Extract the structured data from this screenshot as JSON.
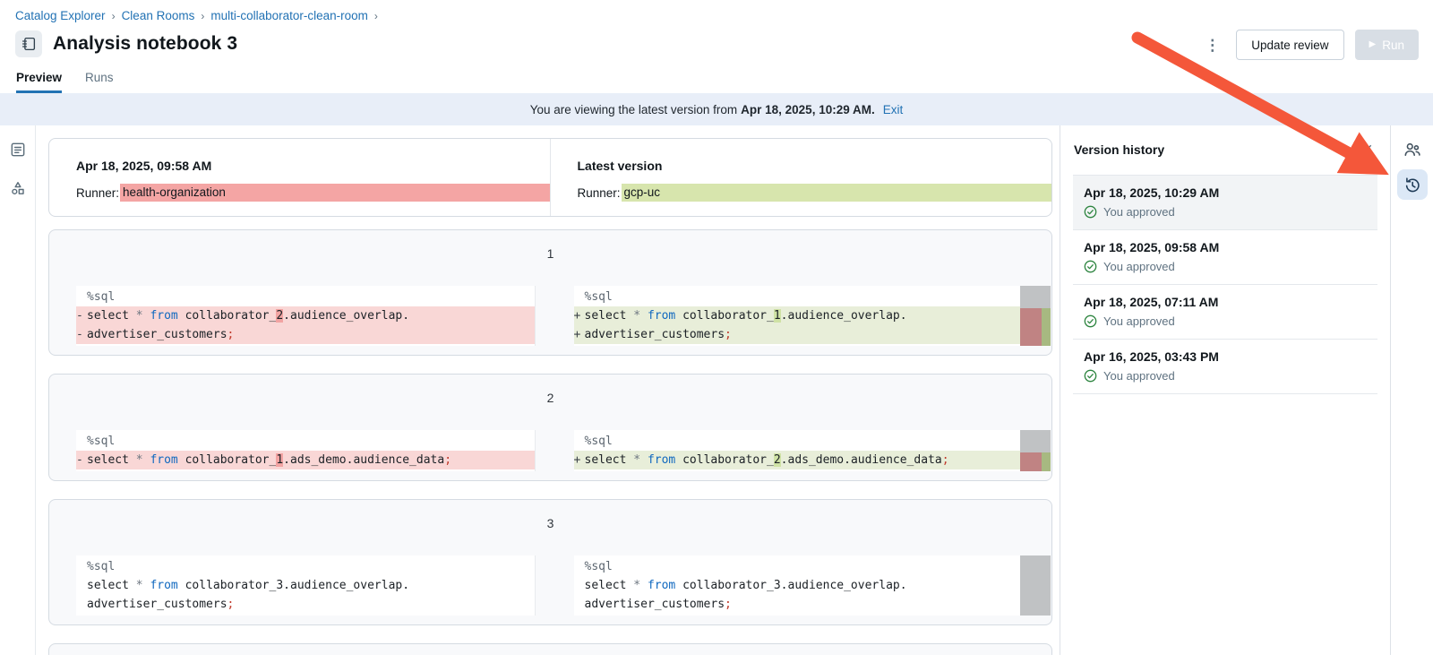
{
  "breadcrumb": {
    "items": [
      "Catalog Explorer",
      "Clean Rooms",
      "multi-collaborator-clean-room"
    ],
    "separator": "›"
  },
  "header": {
    "title": "Analysis notebook 3",
    "update_review_label": "Update review",
    "run_label": "Run"
  },
  "tabs": [
    {
      "label": "Preview",
      "active": true
    },
    {
      "label": "Runs",
      "active": false
    }
  ],
  "banner": {
    "text_prefix": "You are viewing the latest version from",
    "timestamp": "Apr 18, 2025, 10:29 AM.",
    "exit_label": "Exit"
  },
  "compare_header": {
    "left": {
      "title": "Apr 18, 2025, 09:58 AM",
      "runner_label": "Runner:",
      "runner_value": "health-organization",
      "highlight": "removed"
    },
    "right": {
      "title": "Latest version",
      "runner_label": "Runner:",
      "runner_value": "gcp-uc",
      "highlight": "added"
    }
  },
  "diff_cells": [
    {
      "number": "1",
      "left": {
        "lines": [
          {
            "prefix": "",
            "type": "ctx",
            "tokens": [
              [
                "magic",
                "%sql"
              ]
            ]
          },
          {
            "prefix": "-",
            "type": "removed",
            "tokens": [
              [
                "plain",
                "select "
              ],
              [
                "op",
                "*"
              ],
              [
                "plain",
                " "
              ],
              [
                "kw",
                "from"
              ],
              [
                "plain",
                " collaborator_"
              ],
              [
                "hl",
                "2"
              ],
              [
                "plain",
                ".audience_overlap."
              ]
            ]
          },
          {
            "prefix": "-",
            "type": "removed",
            "tokens": [
              [
                "plain",
                "advertiser_customers"
              ],
              [
                "semi",
                ";"
              ]
            ]
          }
        ]
      },
      "right": {
        "lines": [
          {
            "prefix": "",
            "type": "ctx",
            "tokens": [
              [
                "magic",
                "%sql"
              ]
            ]
          },
          {
            "prefix": "+",
            "type": "added",
            "tokens": [
              [
                "plain",
                "select "
              ],
              [
                "op",
                "*"
              ],
              [
                "plain",
                " "
              ],
              [
                "kw",
                "from"
              ],
              [
                "plain",
                " collaborator_"
              ],
              [
                "hl",
                "1"
              ],
              [
                "plain",
                ".audience_overlap."
              ]
            ]
          },
          {
            "prefix": "+",
            "type": "added",
            "tokens": [
              [
                "plain",
                "advertiser_customers"
              ],
              [
                "semi",
                ";"
              ]
            ]
          }
        ]
      },
      "minimap": {
        "thumb_lines": 1,
        "diff_lines": 2
      }
    },
    {
      "number": "2",
      "left": {
        "lines": [
          {
            "prefix": "",
            "type": "ctx",
            "tokens": [
              [
                "magic",
                "%sql"
              ]
            ]
          },
          {
            "prefix": "-",
            "type": "removed",
            "tokens": [
              [
                "plain",
                "select "
              ],
              [
                "op",
                "*"
              ],
              [
                "plain",
                " "
              ],
              [
                "kw",
                "from"
              ],
              [
                "plain",
                " collaborator_"
              ],
              [
                "hl",
                "1"
              ],
              [
                "plain",
                ".ads_demo.audience_data"
              ],
              [
                "semi",
                ";"
              ]
            ]
          }
        ]
      },
      "right": {
        "lines": [
          {
            "prefix": "",
            "type": "ctx",
            "tokens": [
              [
                "magic",
                "%sql"
              ]
            ]
          },
          {
            "prefix": "+",
            "type": "added",
            "tokens": [
              [
                "plain",
                "select "
              ],
              [
                "op",
                "*"
              ],
              [
                "plain",
                " "
              ],
              [
                "kw",
                "from"
              ],
              [
                "plain",
                " collaborator_"
              ],
              [
                "hl",
                "2"
              ],
              [
                "plain",
                ".ads_demo.audience_data"
              ],
              [
                "semi",
                ";"
              ]
            ]
          }
        ]
      },
      "minimap": {
        "thumb_lines": 1,
        "diff_lines": 1
      }
    },
    {
      "number": "3",
      "left": {
        "lines": [
          {
            "prefix": "",
            "type": "ctx",
            "tokens": [
              [
                "magic",
                "%sql"
              ]
            ]
          },
          {
            "prefix": "",
            "type": "ctx",
            "tokens": [
              [
                "plain",
                "select "
              ],
              [
                "op",
                "*"
              ],
              [
                "plain",
                " "
              ],
              [
                "kw",
                "from"
              ],
              [
                "plain",
                " collaborator_3.audience_overlap."
              ]
            ]
          },
          {
            "prefix": "",
            "type": "ctx",
            "tokens": [
              [
                "plain",
                "advertiser_customers"
              ],
              [
                "semi",
                ";"
              ]
            ]
          }
        ]
      },
      "right": {
        "lines": [
          {
            "prefix": "",
            "type": "ctx",
            "tokens": [
              [
                "magic",
                "%sql"
              ]
            ]
          },
          {
            "prefix": "",
            "type": "ctx",
            "tokens": [
              [
                "plain",
                "select "
              ],
              [
                "op",
                "*"
              ],
              [
                "plain",
                " "
              ],
              [
                "kw",
                "from"
              ],
              [
                "plain",
                " collaborator_3.audience_overlap."
              ]
            ]
          },
          {
            "prefix": "",
            "type": "ctx",
            "tokens": [
              [
                "plain",
                "advertiser_customers"
              ],
              [
                "semi",
                ";"
              ]
            ]
          }
        ]
      },
      "minimap": {
        "thumb_lines": 3,
        "diff_lines": 0
      }
    }
  ],
  "version_history": {
    "title": "Version history",
    "items": [
      {
        "date": "Apr 18, 2025, 10:29 AM",
        "status": "You approved",
        "selected": true
      },
      {
        "date": "Apr 18, 2025, 09:58 AM",
        "status": "You approved",
        "selected": false
      },
      {
        "date": "Apr 18, 2025, 07:11 AM",
        "status": "You approved",
        "selected": false
      },
      {
        "date": "Apr 16, 2025, 03:43 PM",
        "status": "You approved",
        "selected": false
      }
    ]
  },
  "icons": {
    "kebab": "⋮",
    "play": "▶",
    "close": "✕"
  },
  "colors": {
    "accent_blue": "#2272b4",
    "banner_bg": "#e8eef8",
    "removed_line": "#f9d7d6",
    "removed_char": "#f2a3a2",
    "removed_runner": "#f4a5a4",
    "added_line": "#e8eed9",
    "added_char": "#cfe2a5",
    "added_runner": "#d7e5ad",
    "keyword_blue": "#1068bf",
    "semicolon_red": "#c0392b",
    "approved_green": "#2e8540",
    "arrow_red": "#f4573a",
    "run_disabled_bg": "#d8dee5",
    "history_active_bg": "#dce8f6"
  }
}
